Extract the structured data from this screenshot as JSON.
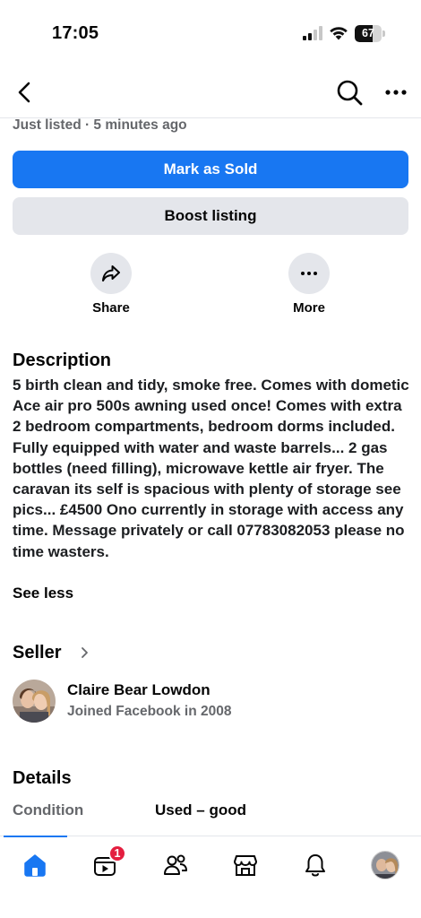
{
  "status_bar": {
    "time": "17:05",
    "battery_level": "67",
    "battery_fraction": 0.67
  },
  "nav": {
    "back_icon": "chevron-left-icon",
    "search_icon": "search-icon",
    "more_icon": "more-horizontal-icon"
  },
  "listing": {
    "listed_text": "Just listed · 5 minutes ago",
    "mark_sold_label": "Mark as Sold",
    "boost_label": "Boost listing",
    "actions": [
      {
        "label": "Share",
        "icon": "share-icon"
      },
      {
        "label": "More",
        "icon": "more-horizontal-icon"
      }
    ]
  },
  "description": {
    "title": "Description",
    "text": "5 birth clean and tidy, smoke free. Comes with dometic Ace air pro 500s awning used once! Comes with extra 2 bedroom compartments, bedroom dorms included. Fully equipped with water and waste barrels... 2 gas bottles (need filling), microwave kettle air fryer. The caravan its self is spacious with plenty of storage see pics... £4500 Ono currently in storage with access any time. Message privately or call 07783082053 please no time wasters.",
    "see_less_label": "See less"
  },
  "seller": {
    "title": "Seller",
    "name": "Claire Bear Lowdon",
    "joined": "Joined Facebook in 2008"
  },
  "details": {
    "title": "Details",
    "condition_label": "Condition",
    "condition_value": "Used – good"
  },
  "tab_bar": {
    "tabs": [
      "home-icon",
      "video-icon",
      "friends-icon",
      "marketplace-icon",
      "notifications-icon",
      "profile-avatar"
    ],
    "video_badge": "1",
    "accent_color": "#1877f2"
  }
}
